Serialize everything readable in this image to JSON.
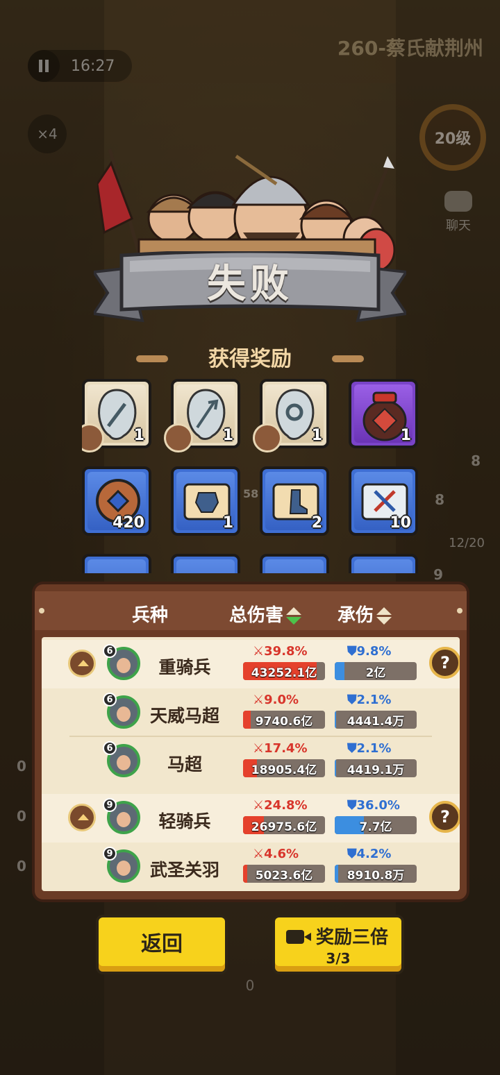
{
  "hud": {
    "time": "16:27",
    "level_title": "260-蔡氏献荆州",
    "speed": "×4",
    "player_level": "20级",
    "chat": "聊天",
    "side_value_a": "8",
    "side_value_b": "8",
    "unit_count": "12/20",
    "left_zero_a": "0",
    "left_zero_b": "0",
    "left_zero_c": "0",
    "bottom_zero": "0",
    "field_number": "58",
    "side_value_c": "9"
  },
  "result": {
    "title": "失败",
    "reward_header": "获得奖励"
  },
  "rewards": [
    {
      "icon": "sword-token-icon",
      "count": "1",
      "rarity": "white"
    },
    {
      "icon": "trident-token-icon",
      "count": "1",
      "rarity": "white"
    },
    {
      "icon": "ring-token-icon",
      "count": "1",
      "rarity": "white"
    },
    {
      "icon": "wine-jar-icon",
      "count": "1",
      "rarity": "purple"
    },
    {
      "icon": "copper-coin-icon",
      "count": "420",
      "rarity": "blue"
    },
    {
      "icon": "armor-scroll-icon",
      "count": "1",
      "rarity": "blue"
    },
    {
      "icon": "boots-scroll-icon",
      "count": "2",
      "rarity": "blue"
    },
    {
      "icon": "weapon-scroll-icon",
      "count": "10",
      "rarity": "blue"
    }
  ],
  "stats": {
    "col_unit": "兵种",
    "col_damage": "总伤害",
    "col_taken": "承伤",
    "rows": [
      {
        "level": "6",
        "name": "重骑兵",
        "dmg_pct": "39.8%",
        "dmg": "43252.1亿",
        "tank_pct": "9.8%",
        "tank": "2亿",
        "group": true,
        "dmg_fill": 0.9,
        "tank_fill": 0.12
      },
      {
        "level": "6",
        "name": "天威马超",
        "dmg_pct": "9.0%",
        "dmg": "9740.6亿",
        "tank_pct": "2.1%",
        "tank": "4441.4万",
        "group": false,
        "dmg_fill": 0.09,
        "tank_fill": 0.02
      },
      {
        "level": "6",
        "name": "马超",
        "dmg_pct": "17.4%",
        "dmg": "18905.4亿",
        "tank_pct": "2.1%",
        "tank": "4419.1万",
        "group": false,
        "dmg_fill": 0.17,
        "tank_fill": 0.02
      },
      {
        "level": "9",
        "name": "轻骑兵",
        "dmg_pct": "24.8%",
        "dmg": "26975.6亿",
        "tank_pct": "36.0%",
        "tank": "7.7亿",
        "group": true,
        "dmg_fill": 0.25,
        "tank_fill": 0.36
      },
      {
        "level": "9",
        "name": "武圣关羽",
        "dmg_pct": "4.6%",
        "dmg": "5023.6亿",
        "tank_pct": "4.2%",
        "tank": "8910.8万",
        "group": false,
        "dmg_fill": 0.05,
        "tank_fill": 0.04
      }
    ]
  },
  "buttons": {
    "back": "返回",
    "triple": "奖励三倍",
    "triple_count": "3/3"
  },
  "colors": {
    "accent": "#f7d21c",
    "damage": "#e5412c",
    "taken": "#3c8ee0"
  }
}
